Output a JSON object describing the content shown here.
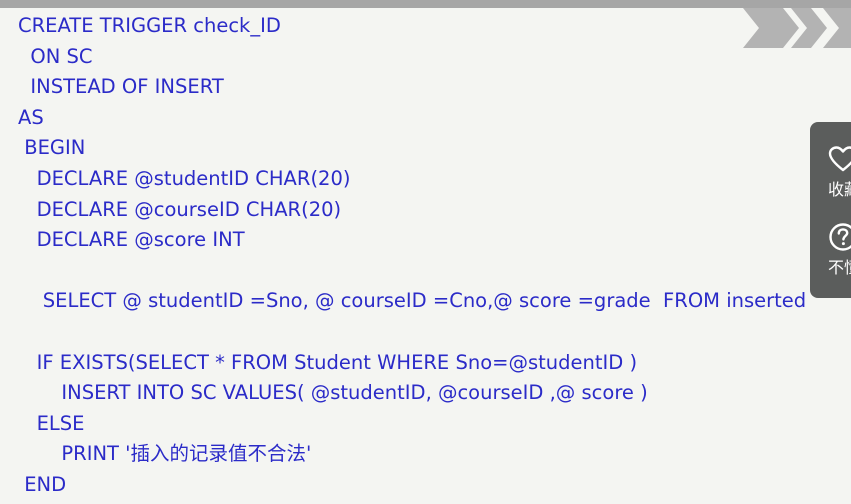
{
  "code": {
    "lines": [
      "CREATE TRIGGER check_ID",
      "  ON SC",
      "  INSTEAD OF INSERT",
      "AS",
      " BEGIN",
      "   DECLARE @studentID CHAR(20)",
      "   DECLARE @courseID CHAR(20)",
      "   DECLARE @score INT",
      "",
      "    SELECT @ studentID =Sno, @ courseID =Cno,@ score =grade  FROM inserted",
      "",
      "   IF EXISTS(SELECT * FROM Student WHERE Sno=@studentID )",
      "       INSERT INTO SC VALUES( @studentID, @courseID ,@ score )",
      "   ELSE",
      "       PRINT '插入的记录值不合法'",
      " END"
    ]
  },
  "side_panel": {
    "favorite": {
      "icon": "heart-icon",
      "label": "收藏"
    },
    "help": {
      "icon": "question-circle-icon",
      "label": "不懂"
    }
  },
  "colors": {
    "code_text": "#2b2bc8",
    "background": "#f4f5f2",
    "panel": "#5b5d5c",
    "chevron": "#b3b3b3"
  }
}
